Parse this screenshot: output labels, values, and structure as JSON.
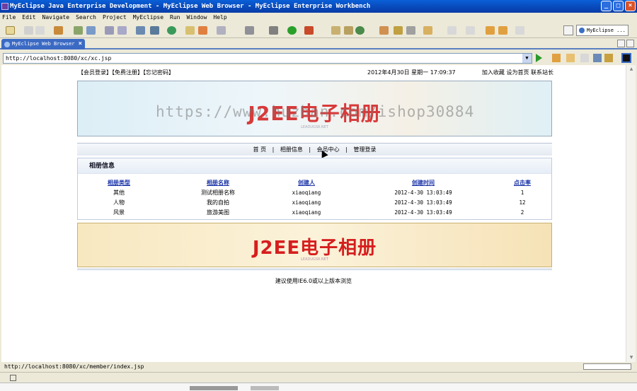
{
  "window": {
    "title": "MyEclipse Java Enterprise Development - MyEclipse Web Browser - MyEclipse Enterprise Workbench",
    "minimize": "_",
    "maximize": "□",
    "close": "×"
  },
  "menu": [
    "File",
    "Edit",
    "Navigate",
    "Search",
    "Project",
    "MyEclipse",
    "Run",
    "Window",
    "Help"
  ],
  "toolbar": {
    "perspective_label": "MyEclipse ..."
  },
  "editor_tab": {
    "label": "MyEclipse Web Browser",
    "close": "×"
  },
  "address_bar": {
    "url": "http://localhost:8080/xc/xc.jsp"
  },
  "status_bar": {
    "text": "http://localhost:8080/xc/member/index.jsp"
  },
  "page": {
    "top_links_left": "【会员登录】【免费注册】【忘记密码】",
    "date_text": "2012年4月30日 星期一 17:09:37",
    "top_links_right": "加入收藏 设为首页 联系站长",
    "banner_title": "J2EE电子相册",
    "banner_sub": "LEADUGSR.NET",
    "watermark": "https://www.huzhan.com/ishop30884",
    "nav": [
      "首 页",
      "|",
      "相册信息",
      "|",
      "会员中心",
      "|",
      "管理登录"
    ],
    "panel_title": "相册信息",
    "table": {
      "headers": [
        "相册类型",
        "相册名称",
        "创建人",
        "创建时间",
        "点击率"
      ],
      "rows": [
        [
          "其他",
          "测试相册名称",
          "xiaoqiang",
          "2012-4-30 13:03:49",
          "1"
        ],
        [
          "人物",
          "我的自拍",
          "xiaoqiang",
          "2012-4-30 13:03:49",
          "12"
        ],
        [
          "风景",
          "旅游美图",
          "xiaoqiang",
          "2012-4-30 13:03:49",
          "2"
        ]
      ]
    },
    "banner2_title": "J2EE电子相册",
    "banner2_sub": "LEADUGSR.NET",
    "footer": "建议使用IE6.0或以上版本浏览"
  },
  "colors": {
    "title_bar": "#0848b8",
    "link_blue": "#1b34a8",
    "banner_red": "#d73a3a"
  }
}
